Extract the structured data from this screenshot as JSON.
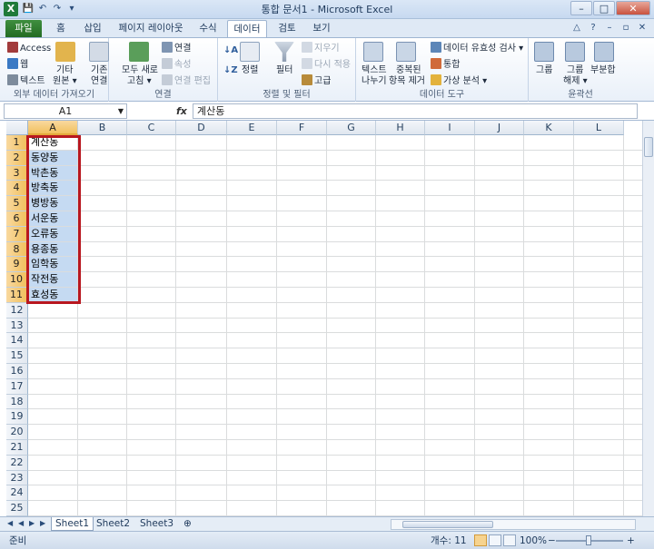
{
  "window": {
    "title": "통합 문서1 - Microsoft Excel",
    "logo_letter": "X",
    "minimize": "–",
    "maximize": "□",
    "close": "✕"
  },
  "qat": {
    "save_icon": "💾",
    "undo_icon": "↶",
    "redo_icon": "↷",
    "customize_icon": "▾"
  },
  "tabs": [
    "파일",
    "홈",
    "삽입",
    "페이지 레이아웃",
    "수식",
    "데이터",
    "검토",
    "보기"
  ],
  "active_tab": "데이터",
  "ribbon": {
    "external": {
      "access": "Access",
      "web": "웹",
      "text": "텍스트",
      "other_line1": "기타",
      "other_line2": "원본 ▾",
      "existing_line1": "기존",
      "existing_line2": "연결",
      "label": "외부 데이터 가져오기"
    },
    "connections": {
      "refresh_line1": "모두 새로",
      "refresh_line2": "고침 ▾",
      "connections": "연결",
      "properties": "속성",
      "edit_links": "연결 편집",
      "label": "연결"
    },
    "sort_filter": {
      "sort": "정렬",
      "filter": "필터",
      "clear": "지우기",
      "reapply": "다시 적용",
      "advanced": "고급",
      "label": "정렬 및 필터"
    },
    "data_tools": {
      "text_cols_line1": "텍스트",
      "text_cols_line2": "나누기",
      "remove_dup_line1": "중복된",
      "remove_dup_line2": "항목 제거",
      "validation": "데이터 유효성 검사 ▾",
      "consolidate": "통합",
      "whatif": "가상 분석 ▾",
      "label": "데이터 도구"
    },
    "outline": {
      "group": "그룹",
      "ungroup_line1": "그룹",
      "ungroup_line2": "해제 ▾",
      "subtotal": "부분합",
      "label": "윤곽선"
    }
  },
  "formula_bar": {
    "name_box": "A1",
    "fx": "fx",
    "content": "계산동"
  },
  "columns": [
    "A",
    "B",
    "C",
    "D",
    "E",
    "F",
    "G",
    "H",
    "I",
    "J",
    "K",
    "L"
  ],
  "rows": [
    "1",
    "2",
    "3",
    "4",
    "5",
    "6",
    "7",
    "8",
    "9",
    "10",
    "11",
    "12",
    "13",
    "14",
    "15",
    "16",
    "17",
    "18",
    "19",
    "20",
    "21",
    "22",
    "23",
    "24",
    "25"
  ],
  "selected_rows": 11,
  "cells_a": [
    "계산동",
    "동양동",
    "박촌동",
    "방축동",
    "병방동",
    "서운동",
    "오류동",
    "용종동",
    "임학동",
    "작전동",
    "효성동"
  ],
  "sheets": [
    "Sheet1",
    "Sheet2",
    "Sheet3"
  ],
  "active_sheet": "Sheet1",
  "status": {
    "ready": "준비",
    "count": "개수: 11",
    "zoom": "100%",
    "zoom_minus": "−",
    "zoom_plus": "+"
  }
}
